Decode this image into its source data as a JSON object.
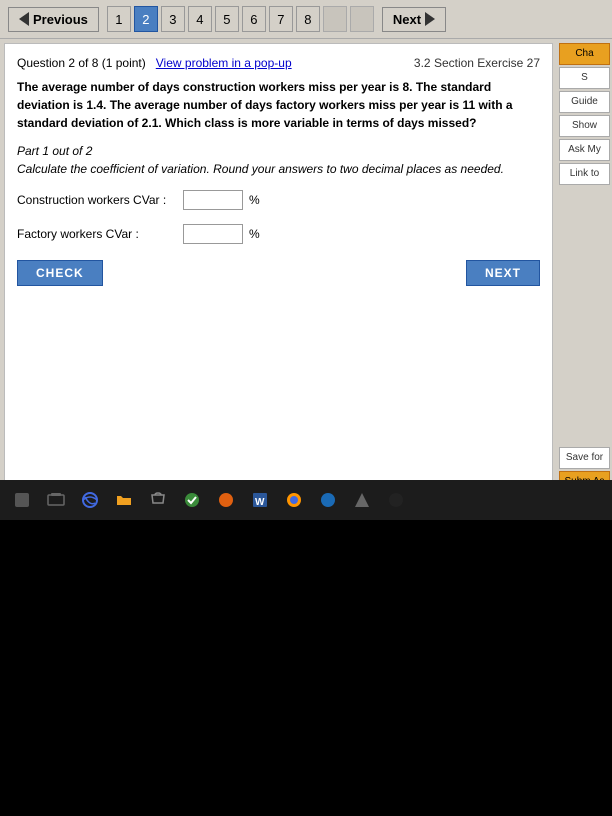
{
  "nav": {
    "prev_label": "Previous",
    "next_label": "Next",
    "pages": [
      {
        "num": "1",
        "active": false
      },
      {
        "num": "2",
        "active": true
      },
      {
        "num": "3",
        "active": false
      },
      {
        "num": "4",
        "active": false
      },
      {
        "num": "5",
        "active": false
      },
      {
        "num": "6",
        "active": false
      },
      {
        "num": "7",
        "active": false
      },
      {
        "num": "8",
        "active": false
      },
      {
        "num": "",
        "active": false
      },
      {
        "num": "",
        "active": false
      }
    ]
  },
  "question": {
    "header": "Question 2 of 8 (1 point)",
    "view_popup": "View problem in a pop-up",
    "section_ref": "3.2 Section Exercise 27",
    "text": "The average number of days construction workers miss per year is 8. The standard deviation is 1.4. The average number of days factory workers miss per year is 11 with a standard deviation of 2.1. Which class is more variable in terms of days missed?",
    "part": "Part 1 out of 2",
    "instruction": "Calculate the coefficient of variation. Round your answers to two decimal places as needed.",
    "construction_label": "Construction workers CVar :",
    "factory_label": "Factory workers CVar :",
    "percent": "%",
    "check_label": "CHECK",
    "next_label": "NEXT"
  },
  "right_panel": {
    "cha_label": "Cha",
    "s_label": "S",
    "guide_label": "Guide",
    "show_label": "Show",
    "ask_label": "Ask My",
    "link_label": "Link to",
    "save_label": "Save for",
    "submit_label": "Subm Assignm"
  }
}
